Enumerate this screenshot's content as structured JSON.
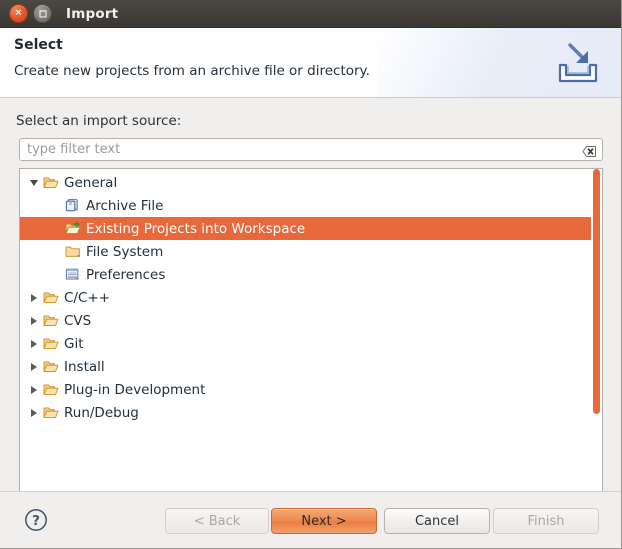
{
  "window": {
    "title": "Import",
    "controls": [
      {
        "name": "close",
        "glyph": "x"
      },
      {
        "name": "maximize",
        "glyph": "square"
      }
    ]
  },
  "header": {
    "title": "Select",
    "description": "Create new projects from an archive file or directory.",
    "icon": "import-wizard-icon"
  },
  "body": {
    "source_label": "Select an import source:",
    "filter": {
      "value": "",
      "placeholder": "type filter text",
      "clear_icon": "clear-field-icon"
    },
    "tree": {
      "selected_index": 2,
      "items": [
        {
          "label": "General",
          "level": 0,
          "expanded": true,
          "icon": "folder-open-icon",
          "selected": false
        },
        {
          "label": "Archive File",
          "level": 1,
          "expanded": null,
          "icon": "archive-file-icon",
          "selected": false
        },
        {
          "label": "Existing Projects into Workspace",
          "level": 1,
          "expanded": null,
          "icon": "import-projects-icon",
          "selected": true
        },
        {
          "label": "File System",
          "level": 1,
          "expanded": null,
          "icon": "folder-icon",
          "selected": false
        },
        {
          "label": "Preferences",
          "level": 1,
          "expanded": null,
          "icon": "preferences-icon",
          "selected": false
        },
        {
          "label": "C/C++",
          "level": 0,
          "expanded": false,
          "icon": "folder-open-icon",
          "selected": false
        },
        {
          "label": "CVS",
          "level": 0,
          "expanded": false,
          "icon": "folder-open-icon",
          "selected": false
        },
        {
          "label": "Git",
          "level": 0,
          "expanded": false,
          "icon": "folder-open-icon",
          "selected": false
        },
        {
          "label": "Install",
          "level": 0,
          "expanded": false,
          "icon": "folder-open-icon",
          "selected": false
        },
        {
          "label": "Plug-in Development",
          "level": 0,
          "expanded": false,
          "icon": "folder-open-icon",
          "selected": false
        },
        {
          "label": "Run/Debug",
          "level": 0,
          "expanded": false,
          "icon": "folder-open-icon",
          "selected": false
        }
      ]
    }
  },
  "footer": {
    "help_icon": "help-question-icon",
    "buttons": [
      {
        "label": "< Back",
        "state": "disabled"
      },
      {
        "label": "Next >",
        "state": "default"
      },
      {
        "label": "Cancel",
        "state": "normal"
      },
      {
        "label": "Finish",
        "state": "disabled"
      }
    ]
  },
  "colors": {
    "selection": "#e8683c",
    "default_button": "#ef8c52",
    "titlebar": "#423e3a",
    "dialog_bg": "#f0efee"
  }
}
